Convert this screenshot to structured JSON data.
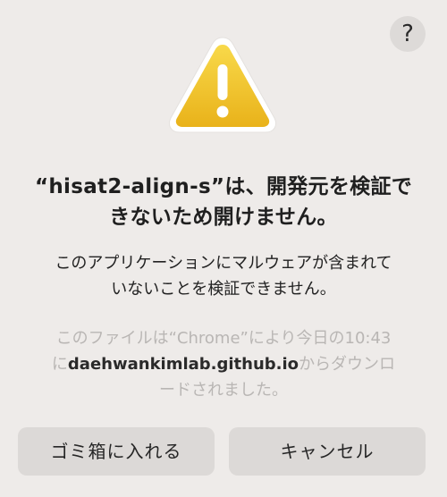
{
  "help_button": {
    "label": "?"
  },
  "title": {
    "line1": "“hisat2-align-s”は、開発元を検証で",
    "line2": "きないため開けません。"
  },
  "message": {
    "line1": "このアプリケーションにマルウェアが含まれて",
    "line2": "いないことを検証できません。"
  },
  "info": {
    "line1": "このファイルは“Chrome”により今日の10:43",
    "line2_prefix": "に",
    "line2_domain": "daehwankimlab.github.io",
    "line2_suffix": "からダウンロ",
    "line3": "ードされました。"
  },
  "buttons": {
    "move_to_trash": "ゴミ箱に入れる",
    "cancel": "キャンセル"
  },
  "icon": {
    "warning": "warning-triangle-icon",
    "help": "question-mark-icon"
  },
  "colors": {
    "background": "#eeebe9",
    "button": "#dcd9d7",
    "warning_yellow": "#f2c42a",
    "dim_text": "#b9b6b4"
  }
}
